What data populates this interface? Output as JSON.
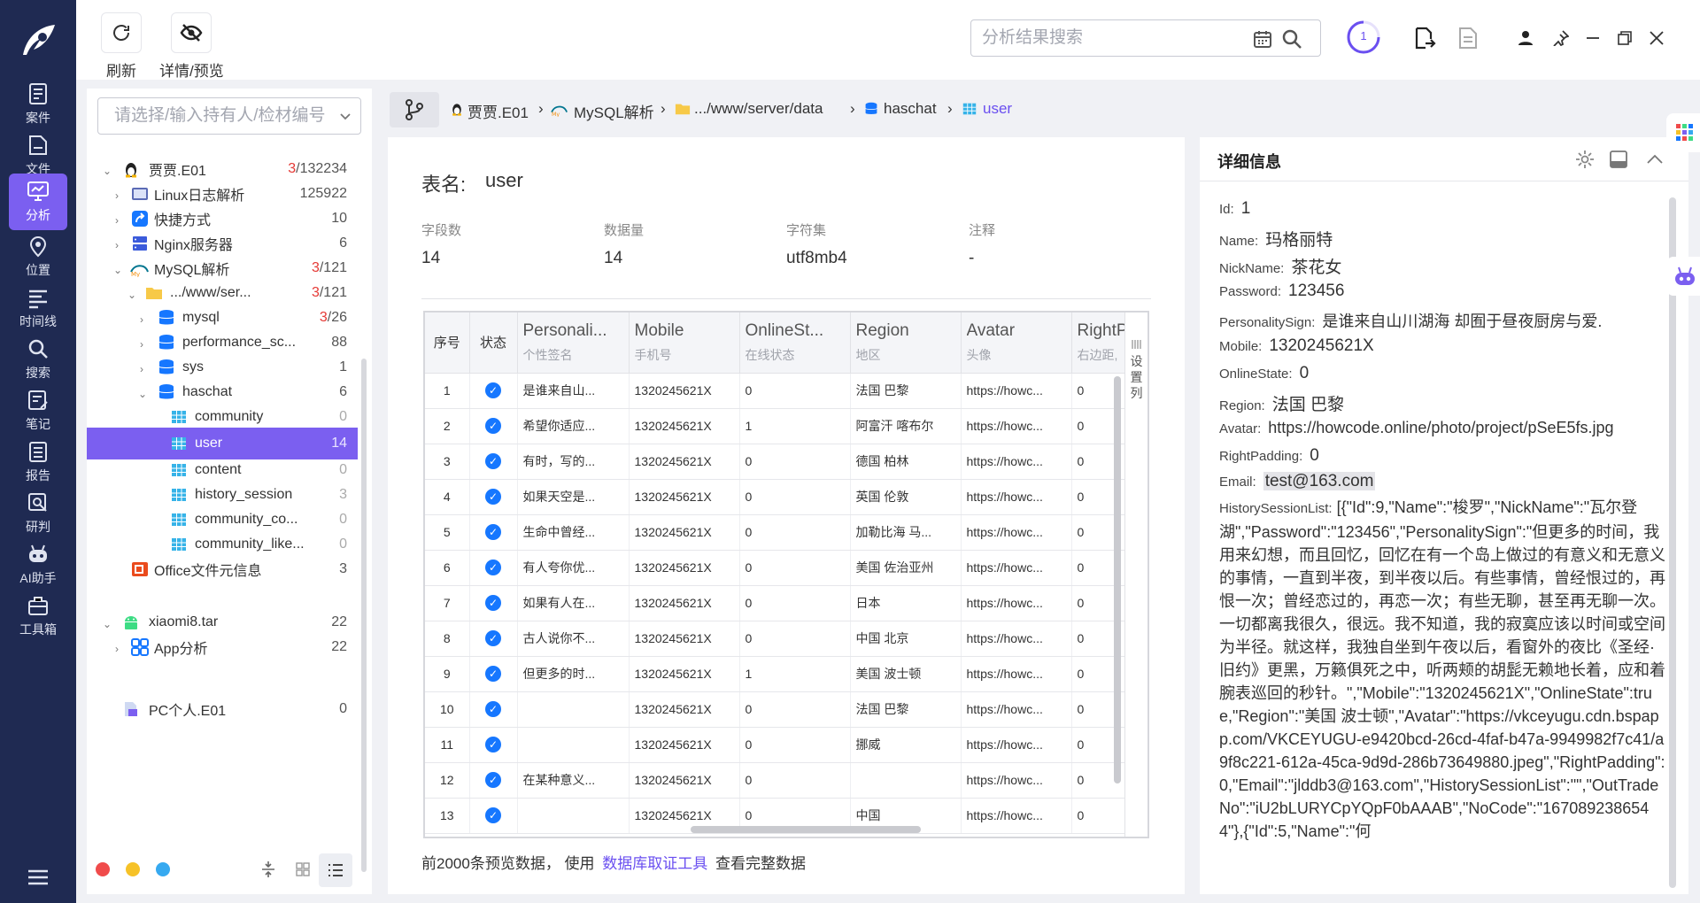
{
  "nav": {
    "items": [
      {
        "label": "案件",
        "icon": "case-icon"
      },
      {
        "label": "文件",
        "icon": "file-icon"
      },
      {
        "label": "分析",
        "icon": "analysis-icon"
      },
      {
        "label": "位置",
        "icon": "location-icon"
      },
      {
        "label": "时间线",
        "icon": "timeline-icon"
      },
      {
        "label": "搜索",
        "icon": "search-icon"
      },
      {
        "label": "笔记",
        "icon": "note-icon"
      },
      {
        "label": "报告",
        "icon": "report-icon"
      },
      {
        "label": "研判",
        "icon": "judge-icon"
      },
      {
        "label": "AI助手",
        "icon": "ai-assistant-icon"
      },
      {
        "label": "工具箱",
        "icon": "toolbox-icon"
      }
    ],
    "active_index": 2
  },
  "toolbar": {
    "refresh_label": "刷新",
    "detail_preview_label": "详情/预览",
    "search_placeholder": "分析结果搜索",
    "task_count": "1"
  },
  "tree": {
    "owner_placeholder": "请选择/输入持有人/检材编号",
    "nodes": [
      {
        "label": "贾贾.E01",
        "count_red": "3",
        "count": "/132234"
      },
      {
        "label": "Linux日志解析",
        "count_red": "",
        "count": "125922"
      },
      {
        "label": "快捷方式",
        "count_red": "",
        "count": "10"
      },
      {
        "label": "Nginx服务器",
        "count_red": "",
        "count": "6"
      },
      {
        "label": "MySQL解析",
        "count_red": "3",
        "count": "/121"
      },
      {
        "label": ".../www/ser...",
        "count_red": "3",
        "count": "/121"
      },
      {
        "label": "mysql",
        "count_red": "3",
        "count": "/26"
      },
      {
        "label": "performance_sc...",
        "count_red": "",
        "count": "88"
      },
      {
        "label": "sys",
        "count_red": "",
        "count": "1"
      },
      {
        "label": "haschat",
        "count_red": "",
        "count": "6"
      },
      {
        "label": "community",
        "count_red": "",
        "count": "0"
      },
      {
        "label": "user",
        "count_red": "",
        "count": "14"
      },
      {
        "label": "content",
        "count_red": "",
        "count": "0"
      },
      {
        "label": "history_session",
        "count_red": "",
        "count": "3"
      },
      {
        "label": "community_co...",
        "count_red": "",
        "count": "0"
      },
      {
        "label": "community_like...",
        "count_red": "",
        "count": "0"
      },
      {
        "label": "Office文件元信息",
        "count_red": "",
        "count": "3"
      },
      {
        "label": "xiaomi8.tar",
        "count_red": "",
        "count": "22"
      },
      {
        "label": "App分析",
        "count_red": "",
        "count": "22"
      },
      {
        "label": "PC个人.E01",
        "count_red": "",
        "count": "0"
      }
    ]
  },
  "breadcrumb": [
    "贾贾.E01",
    "MySQL解析",
    ".../www/server/data",
    "haschat",
    "user"
  ],
  "table_info": {
    "name_label": "表名:",
    "name": "user",
    "field_count_label": "字段数",
    "field_count": "14",
    "data_count_label": "数据量",
    "data_count": "14",
    "charset_label": "字符集",
    "charset": "utf8mb4",
    "comment_label": "注释",
    "comment": "-"
  },
  "grid": {
    "columns": [
      {
        "en": "序号",
        "zh": ""
      },
      {
        "en": "状态",
        "zh": ""
      },
      {
        "en": "Personali...",
        "zh": "个性签名"
      },
      {
        "en": "Mobile",
        "zh": "手机号"
      },
      {
        "en": "OnlineSt...",
        "zh": "在线状态"
      },
      {
        "en": "Region",
        "zh": "地区"
      },
      {
        "en": "Avatar",
        "zh": "头像"
      },
      {
        "en": "RightP",
        "zh": "右边距,"
      }
    ],
    "column_settings_label": "设置列",
    "rows": [
      [
        "1",
        "是谁来自山...",
        "1320245621X",
        "0",
        "法国 巴黎",
        "https://howc...",
        "0"
      ],
      [
        "2",
        "希望你适应...",
        "1320245621X",
        "1",
        "阿富汗 喀布尔",
        "https://howc...",
        "0"
      ],
      [
        "3",
        "有时，写的...",
        "1320245621X",
        "0",
        "德国 柏林",
        "https://howc...",
        "0"
      ],
      [
        "4",
        "如果天空是...",
        "1320245621X",
        "0",
        "英国 伦敦",
        "https://howc...",
        "0"
      ],
      [
        "5",
        "生命中曾经...",
        "1320245621X",
        "0",
        "加勒比海 马...",
        "https://howc...",
        "0"
      ],
      [
        "6",
        "有人夸你优...",
        "1320245621X",
        "0",
        "美国 佐治亚州",
        "https://howc...",
        "0"
      ],
      [
        "7",
        "如果有人在...",
        "1320245621X",
        "0",
        "日本",
        "https://howc...",
        "0"
      ],
      [
        "8",
        "古人说你不...",
        "1320245621X",
        "0",
        "中国 北京",
        "https://howc...",
        "0"
      ],
      [
        "9",
        "但更多的时...",
        "1320245621X",
        "1",
        "美国 波士顿",
        "https://howc...",
        "0"
      ],
      [
        "10",
        "",
        "1320245621X",
        "0",
        "法国 巴黎",
        "https://howc...",
        "0"
      ],
      [
        "11",
        "",
        "1320245621X",
        "0",
        "挪威",
        "https://howc...",
        "0"
      ],
      [
        "12",
        "在某种意义...",
        "1320245621X",
        "0",
        "",
        "https://howc...",
        "0"
      ],
      [
        "13",
        "",
        "1320245621X",
        "0",
        "中国",
        "https://howc...",
        "0"
      ]
    ],
    "footer_prefix": "前2000条预览数据，  使用",
    "footer_link": "数据库取证工具",
    "footer_suffix": "查看完整数据"
  },
  "detail": {
    "title": "详细信息",
    "fields": [
      {
        "k": "Id:",
        "v": "1"
      },
      {
        "k": "Name:",
        "v": "玛格丽特"
      },
      {
        "k": "NickName:",
        "v": "茶花女"
      },
      {
        "k": "Password:",
        "v": "123456"
      },
      {
        "k": "PersonalitySign:",
        "v": "是谁来自山川湖海 却囿于昼夜厨房与爱."
      },
      {
        "k": "Mobile:",
        "v": "1320245621X"
      },
      {
        "k": "OnlineState:",
        "v": "0"
      },
      {
        "k": "Region:",
        "v": "法国 巴黎"
      },
      {
        "k": "Avatar:",
        "v": "https://howcode.online/photo/project/pSeE5fs.jpg"
      },
      {
        "k": "RightPadding:",
        "v": "0"
      },
      {
        "k": "Email:",
        "v": "test@163.com"
      }
    ],
    "history_key": "HistorySessionList:",
    "history_value": "[{\"Id\":9,\"Name\":\"梭罗\",\"NickName\":\"瓦尔登湖\",\"Password\":\"123456\",\"PersonalitySign\":\"但更多的时间，我用来幻想，而且回忆，回忆在有一个岛上做过的有意义和无意义的事情，一直到半夜，到半夜以后。有些事情，曾经恨过的，再恨一次；曾经恋过的，再恋一次；有些无聊，甚至再无聊一次。一切都离我很久，很远。我不知道，我的寂寞应该以时间或空间为半径。就这样，我独自坐到午夜以后，看窗外的夜比《圣经·旧约》更黑，万籁俱死之中，听两颊的胡髭无赖地长着，应和着腕表巡回的秒针。\",\"Mobile\":\"1320245621X\",\"OnlineState\":true,\"Region\":\"美国 波士顿\",\"Avatar\":\"https://vkceyugu.cdn.bspapp.com/VKCEYUGU-e9420bcd-26cd-4faf-b47a-9949982f7c41/a9f8c221-612a-45ca-9d9d-286b73649880.jpeg\",\"RightPadding\":0,\"Email\":\"jlddb3@163.com\",\"HistorySessionList\":\"\",\"OutTradeNo\":\"iU2bLURYCpYQpF0bAAAB\",\"NoCode\":\"1670892386544\"},{\"Id\":5,\"Name\":\"何"
  },
  "colors": {
    "accent": "#7b5ff0",
    "nav_bg": "#1f2a52",
    "check": "#1677ff",
    "red": "#e53935"
  }
}
